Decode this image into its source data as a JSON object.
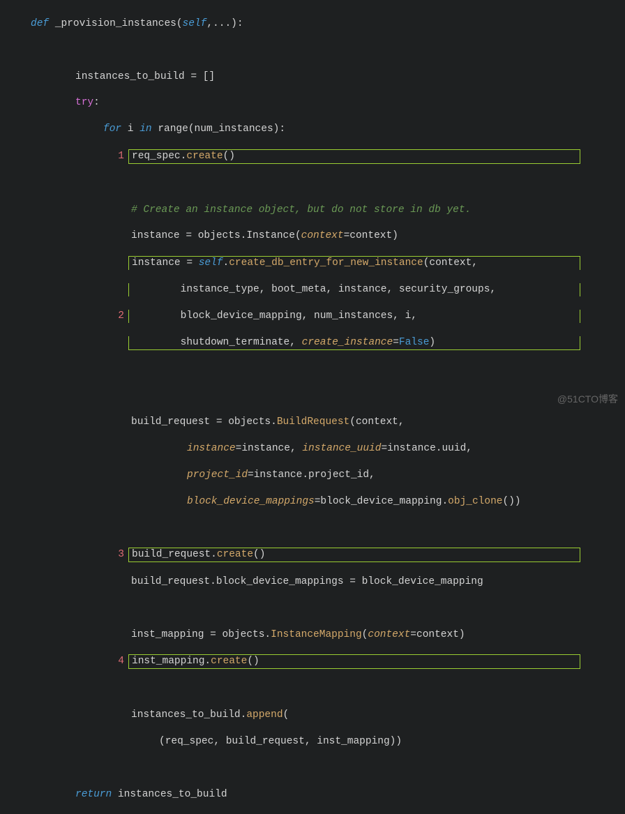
{
  "watermark": "@51CTO博客",
  "annotations": {
    "a1": "1",
    "a2": "2",
    "a3": "3",
    "a4": "4"
  },
  "code": {
    "l1_def": "def",
    "l1_fn": "_provision_instances",
    "l1_self": "self",
    "l1_tail": ",...):",
    "l3_a": "instances_to_build = []",
    "l4_try": "try",
    "l4_colon": ":",
    "l5_for": "for",
    "l5_i": " i ",
    "l5_in": "in",
    "l5_range": " range(num_instances):",
    "l6_a": "req_spec.",
    "l6_m": "create",
    "l6_b": "()",
    "l8_cmt": "# Create an instance object, but do not store in db yet.",
    "l9_a": "instance = objects.Instance(",
    "l9_p": "context",
    "l9_b": "=context)",
    "l10_a": "instance = ",
    "l10_self": "self",
    "l10_b": ".",
    "l10_m": "create_db_entry_for_new_instance",
    "l10_c": "(context,",
    "l11": "instance_type, boot_meta, instance, security_groups,",
    "l12": "block_device_mapping, num_instances, i,",
    "l13_a": "shutdown_terminate, ",
    "l13_p": "create_instance",
    "l13_b": "=",
    "l13_c": "False",
    "l13_d": ")",
    "l16_a": "build_request = objects.",
    "l16_m": "BuildRequest",
    "l16_b": "(context,",
    "l17_p1": "instance",
    "l17_a": "=instance, ",
    "l17_p2": "instance_uuid",
    "l17_b": "=instance.uuid,",
    "l18_p": "project_id",
    "l18_a": "=instance.project_id,",
    "l19_p": "block_device_mappings",
    "l19_a": "=block_device_mapping.",
    "l19_m": "obj_clone",
    "l19_b": "())",
    "l21_a": "build_request.",
    "l21_m": "create",
    "l21_b": "()",
    "l22": "build_request.block_device_mappings = block_device_mapping",
    "l24_a": "inst_mapping = objects.",
    "l24_m": "InstanceMapping",
    "l24_b": "(",
    "l24_p": "context",
    "l24_c": "=context)",
    "l25_a": "inst_mapping.",
    "l25_m": "create",
    "l25_b": "()",
    "l27_a": "instances_to_build.",
    "l27_m": "append",
    "l27_b": "(",
    "l28": "(req_spec, build_request, inst_mapping))",
    "l30_ret": "return",
    "l30_a": " instances_to_build"
  }
}
